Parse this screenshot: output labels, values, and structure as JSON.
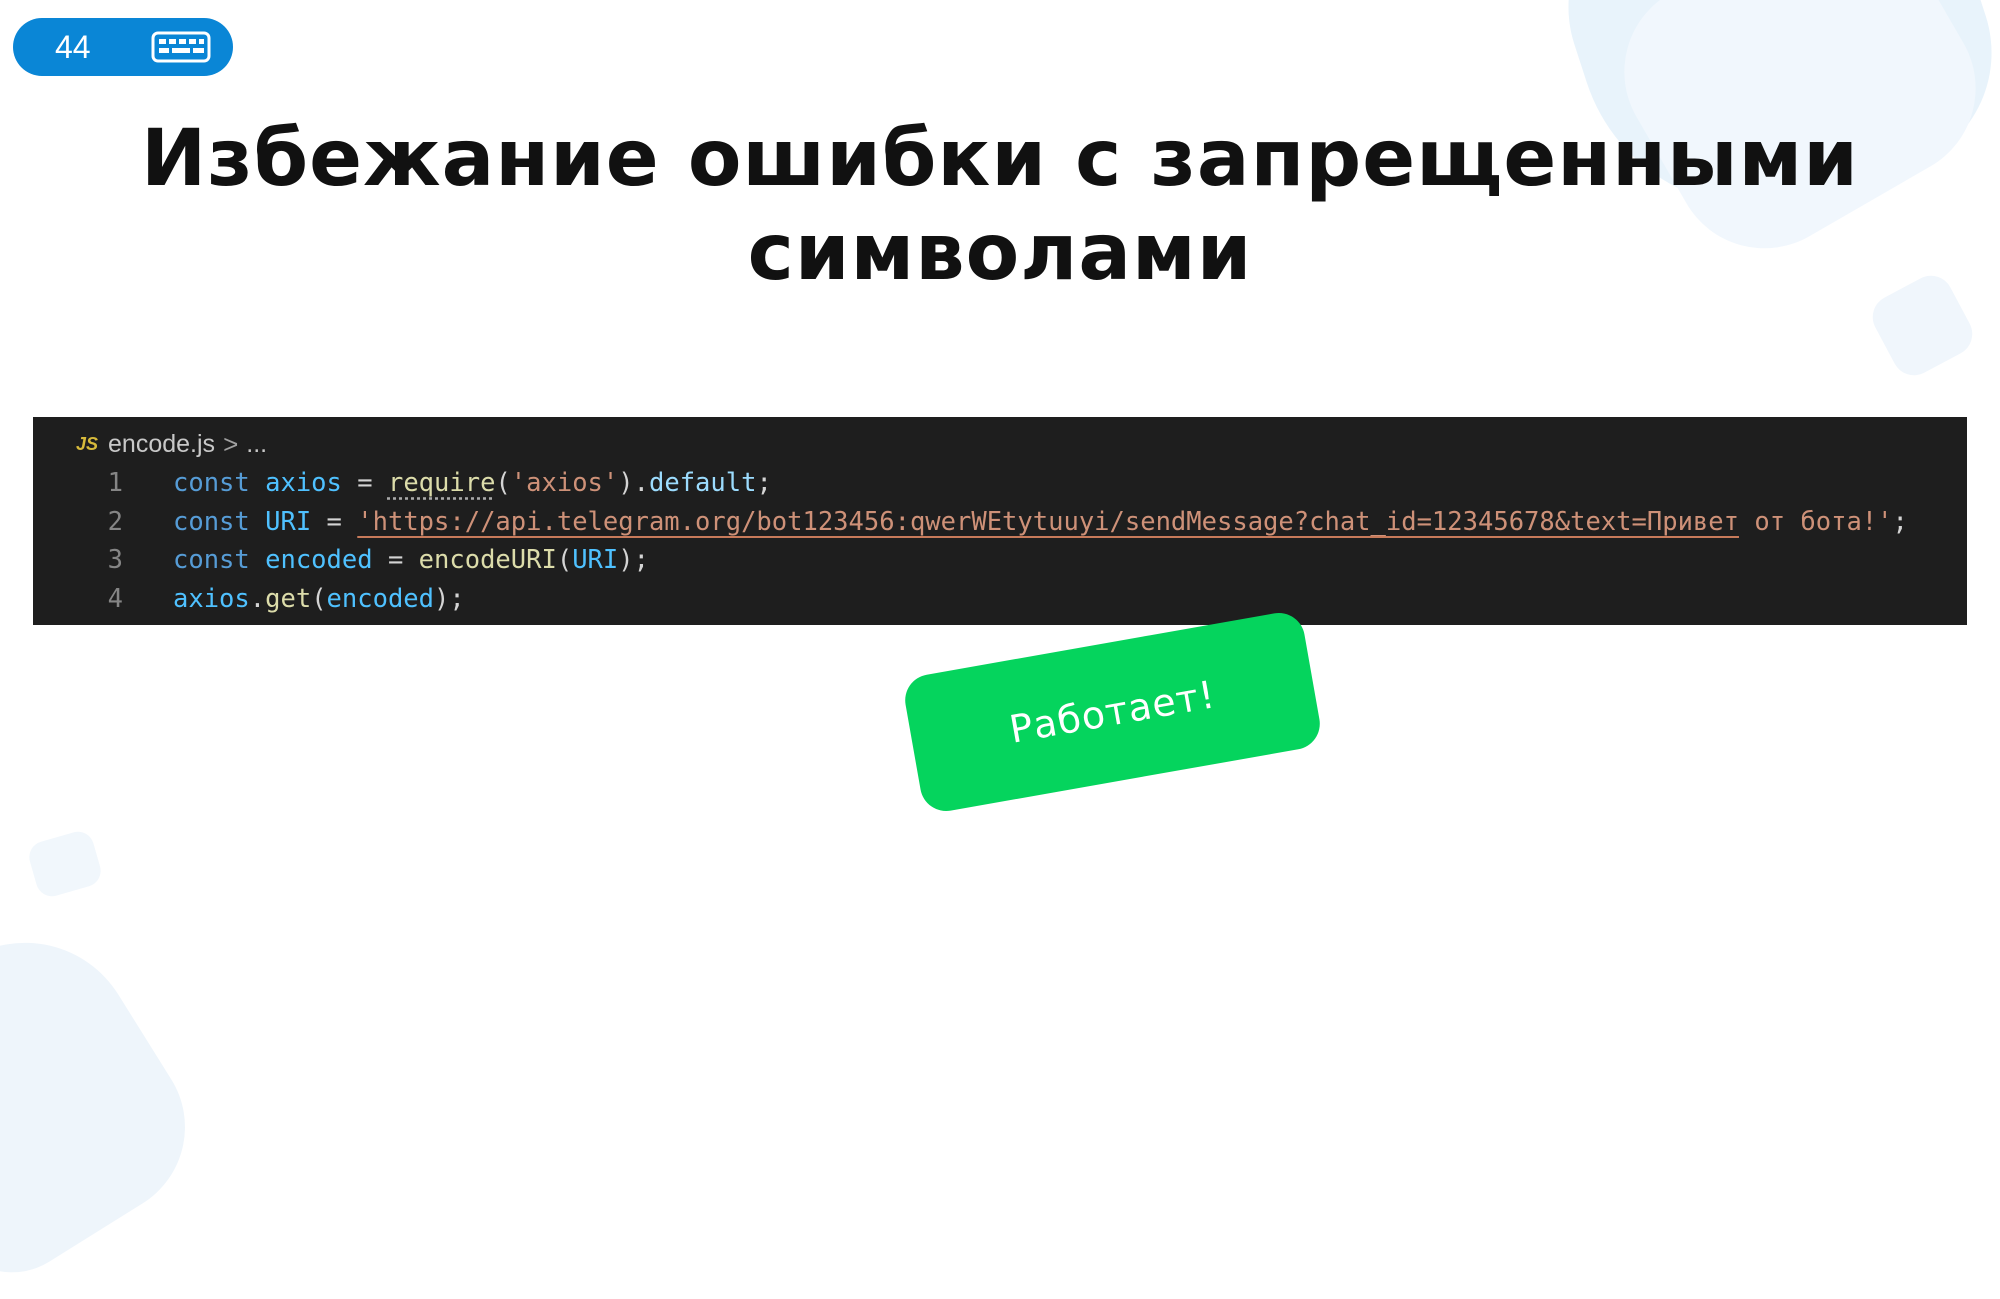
{
  "slide": {
    "number": "44",
    "keyboard_icon": "keyboard-icon",
    "accent_color": "#0a86d6"
  },
  "title": {
    "line1": "Избежание ошибки с запрещенными",
    "line2": "символами"
  },
  "editor": {
    "file_badge": "JS",
    "file_name": "encode.js",
    "breadcrumb_separator": ">",
    "breadcrumb_more": "...",
    "background": "#1e1e1e",
    "lines": [
      {
        "number": "1",
        "tokens": [
          "const",
          "axios",
          "=",
          "require",
          "(",
          "'axios'",
          ")",
          ".",
          "default",
          ";"
        ]
      },
      {
        "number": "2",
        "tokens": [
          "const",
          "URI",
          "=",
          "'https://api.telegram.org/bot123456:qwerWEtytuuyi/sendMessage?chat_id=12345678&text=Привет",
          "от бота!'",
          ";"
        ]
      },
      {
        "number": "3",
        "tokens": [
          "const",
          "encoded",
          "=",
          "encodeURI",
          "(",
          "URI",
          ");"
        ]
      },
      {
        "number": "4",
        "tokens": [
          "axios",
          ".",
          "get",
          "(",
          "encoded",
          ");"
        ]
      }
    ]
  },
  "sticker": {
    "label": "Работает!",
    "color": "#05d45d"
  }
}
